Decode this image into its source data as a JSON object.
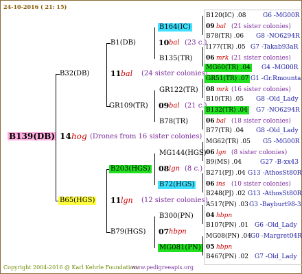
{
  "header": {
    "date": "24-10-2016 ( 21: 15)"
  },
  "footer": {
    "copyright": "Copyright 2004-2016 @ Karl Kehrle Foundation.",
    "website": "www.pedigreeapis.org"
  },
  "root": {
    "name": "B139(DB)",
    "gen": "14",
    "note": "hog",
    "desc": "(Drones from 16 sister colonies)"
  },
  "g1_top": {
    "name": "B32(DB)",
    "gen": "11",
    "note": "bal",
    "desc": "(24 sister colonies)"
  },
  "g1_bot": {
    "name": "B65(HGS)",
    "gen": "11",
    "note": "lgn",
    "desc": "(12 sister colonies)"
  },
  "g2": [
    {
      "name": "B1(DB)",
      "gen": "10",
      "note": "bal",
      "desc": "(23 c.)"
    },
    {
      "name": "GR109(TR)",
      "gen": "09",
      "note": "bal",
      "desc": "(21 c.)"
    },
    {
      "name": "B203(HGS)",
      "gen": "08",
      "note": "lgn",
      "desc": "(8 c.)"
    },
    {
      "name": "B79(HGS)",
      "gen": "07",
      "note": "hbpn",
      "desc": ""
    }
  ],
  "g3": [
    {
      "name": "B164(IC)"
    },
    {
      "name": "B135(TR)"
    },
    {
      "name": "GR122(TR)"
    },
    {
      "name": "B78(TR)"
    },
    {
      "name": "MG144(HGS)"
    },
    {
      "name": "B72(HGS)"
    },
    {
      "name": "B300(PN)"
    },
    {
      "name": "MG081(PN)"
    }
  ],
  "g4": [
    {
      "top": "B120(IC) .08",
      "topsrc": "G6 -MG00R",
      "gen": "09",
      "note": "bal",
      "desc": "(21 sister colonies)",
      "bot": "B78(TR) .06",
      "botsrc": "G8 -NO6294R"
    },
    {
      "top": "I177(TR) .05",
      "topsrc": "G7 -Takab93aR",
      "gen": "06",
      "note": "mrk",
      "desc": "(21 sister colonies)",
      "bot": "MG60(TR) .04",
      "botsrc": "G4 -MG00R"
    },
    {
      "top": "GR51(TR) .07",
      "topsrc": "G1 -Gr.Rmounta",
      "gen": "08",
      "note": "mrk",
      "desc": "(16 sister colonies)",
      "bot": "B10(TR) .05",
      "botsrc": "G8 -Old_Lady"
    },
    {
      "top": "B132(TR) .04",
      "topsrc": "G7 -NO6294R",
      "gen": "06",
      "note": "bal",
      "desc": "(18 sister colonies)",
      "bot": "B77(TR) .04",
      "botsrc": "G8 -Old_Lady"
    },
    {
      "top": "MG62(TR) .05",
      "topsrc": "G5 -MG00R",
      "gen": "06",
      "note": "lgn",
      "desc": "(8 sister colonies)",
      "bot": "B9(MS) .04",
      "botsrc": "G27 -B-xx43"
    },
    {
      "top": "B271(PJ) .04",
      "topsrc": "G13 -AthosSt80R",
      "gen": "06",
      "note": "ins",
      "desc": "(10 sister colonies)",
      "bot": "B248(PJ) .02",
      "botsrc": "G13 -AthosSt80R"
    },
    {
      "top": "A517(PN) .03",
      "topsrc": "G3 -Bayburt98-3",
      "gen": "04",
      "note": "hbpn",
      "desc": "",
      "bot": "B107(PN) .01",
      "botsrc": "G6 -Old_Lady"
    },
    {
      "top": "MG08(PN) .04",
      "topsrc": "G0 -Margret04R",
      "gen": "05",
      "note": "hbpn",
      "desc": "",
      "bot": "B467(PN) .02",
      "botsrc": "G7 -Old_Lady"
    }
  ]
}
